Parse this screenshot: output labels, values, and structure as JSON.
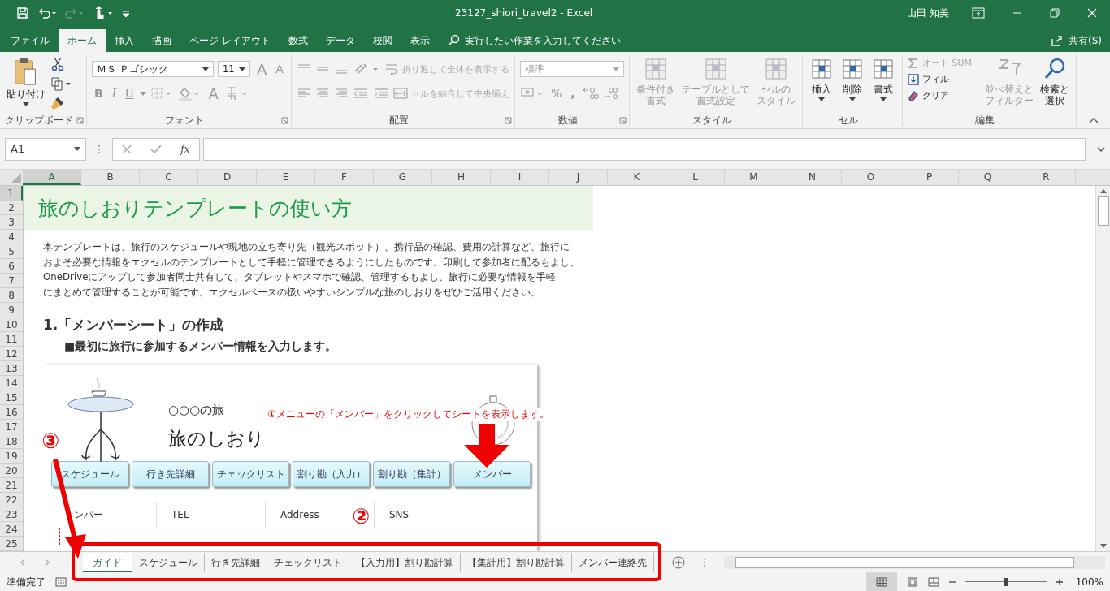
{
  "title_bar": {
    "title": "23127_shiori_travel2  -  Excel",
    "user": "山田 知美"
  },
  "menu_tabs": [
    {
      "label": "ファイル",
      "selected": false
    },
    {
      "label": "ホーム",
      "selected": true
    },
    {
      "label": "挿入",
      "selected": false
    },
    {
      "label": "描画",
      "selected": false
    },
    {
      "label": "ページ レイアウト",
      "selected": false
    },
    {
      "label": "数式",
      "selected": false
    },
    {
      "label": "データ",
      "selected": false
    },
    {
      "label": "校閲",
      "selected": false
    },
    {
      "label": "表示",
      "selected": false
    }
  ],
  "tell_me": {
    "placeholder": "実行したい作業を入力してください"
  },
  "share": "共有(S)",
  "ribbon": {
    "clipboard": {
      "name": "クリップボード",
      "paste": "貼り付け"
    },
    "font": {
      "name": "フォント",
      "font_name": "ＭＳ Ｐゴシック",
      "font_size": "11",
      "size_buttons": [
        "A",
        "A"
      ],
      "styles": [
        "B",
        "I",
        "U"
      ],
      "font_color": "A"
    },
    "alignment": {
      "name": "配置",
      "items": [
        {
          "label": "折り返して全体を表示する",
          "disabled": true
        },
        {
          "label": "セルを結合して中央揃え",
          "disabled": true
        }
      ]
    },
    "number": {
      "name": "数値",
      "format": {
        "value": "標準",
        "disabled": true
      },
      "percent": "%",
      "comma": ","
    },
    "styles": {
      "name": "スタイル",
      "items": [
        {
          "lines": [
            "条件付き",
            "書式"
          ],
          "disabled": true
        },
        {
          "lines": [
            "テーブルとして",
            "書式設定"
          ],
          "disabled": true
        },
        {
          "lines": [
            "セルの",
            "スタイル"
          ],
          "disabled": true
        }
      ]
    },
    "cells": {
      "name": "セル",
      "items": [
        {
          "lines": [
            "挿入"
          ],
          "disabled": false
        },
        {
          "lines": [
            "削除"
          ],
          "disabled": false
        },
        {
          "lines": [
            "書式"
          ],
          "disabled": false
        }
      ]
    },
    "editing": {
      "name": "編集",
      "small": [
        {
          "label": "オート SUM",
          "disabled": true
        },
        {
          "label": "フィル",
          "disabled": false
        },
        {
          "label": "クリア",
          "disabled": false
        }
      ],
      "big": [
        {
          "lines": [
            "並べ替えと",
            "フィルター"
          ],
          "disabled": true
        },
        {
          "lines": [
            "検索と",
            "選択"
          ],
          "disabled": false
        }
      ]
    }
  },
  "formula_bar": {
    "name_box": "A1",
    "fx": "fx"
  },
  "columns": [
    {
      "label": "A",
      "selected": true
    },
    {
      "label": "B",
      "selected": false
    },
    {
      "label": "C",
      "selected": false
    },
    {
      "label": "D",
      "selected": false
    },
    {
      "label": "E",
      "selected": false
    },
    {
      "label": "F",
      "selected": false
    },
    {
      "label": "G",
      "selected": false
    },
    {
      "label": "H",
      "selected": false
    },
    {
      "label": "I",
      "selected": false
    },
    {
      "label": "J",
      "selected": false
    },
    {
      "label": "K",
      "selected": false
    },
    {
      "label": "L",
      "selected": false
    },
    {
      "label": "M",
      "selected": false
    },
    {
      "label": "N",
      "selected": false
    },
    {
      "label": "O",
      "selected": false
    },
    {
      "label": "P",
      "selected": false
    },
    {
      "label": "Q",
      "selected": false
    },
    {
      "label": "R",
      "selected": false
    }
  ],
  "rows": [
    {
      "label": "1",
      "selected": true
    },
    {
      "label": "2",
      "selected": false
    },
    {
      "label": "3",
      "selected": false
    },
    {
      "label": "4",
      "selected": false
    },
    {
      "label": "5",
      "selected": false
    },
    {
      "label": "6",
      "selected": false
    },
    {
      "label": "7",
      "selected": false
    },
    {
      "label": "8",
      "selected": false
    },
    {
      "label": "9",
      "selected": false
    },
    {
      "label": "10",
      "selected": false
    },
    {
      "label": "11",
      "selected": false
    },
    {
      "label": "12",
      "selected": false
    },
    {
      "label": "13",
      "selected": false
    },
    {
      "label": "14",
      "selected": false
    },
    {
      "label": "15",
      "selected": false
    },
    {
      "label": "16",
      "selected": false
    },
    {
      "label": "17",
      "selected": false
    },
    {
      "label": "18",
      "selected": false
    },
    {
      "label": "19",
      "selected": false
    },
    {
      "label": "20",
      "selected": false
    },
    {
      "label": "21",
      "selected": false
    },
    {
      "label": "22",
      "selected": false
    },
    {
      "label": "23",
      "selected": false
    },
    {
      "label": "24",
      "selected": false
    },
    {
      "label": "25",
      "selected": false
    }
  ],
  "sheet": {
    "title": "旅のしおりテンプレートの使い方",
    "paragraph_lines": [
      "本テンプレートは、旅行のスケジュールや現地の立ち寄り先（観光スポット）、携行品の確認、費用の計算など、旅行に",
      "およそ必要な情報をエクセルのテンプレートとして手軽に管理できるようにしたものです。印刷して参加者に配るもよし、",
      "OneDriveにアップして参加者同士共有して、タブレットやスマホで確認、管理するもよし、旅行に必要な情報を手軽",
      "にまとめて管理することが可能です。エクセルベースの扱いやすいシンプルな旅のしおりをぜひご活用ください。"
    ],
    "heading": "1.「メンバーシート」の作成",
    "subheading": "■最初に旅行に参加するメンバー情報を入力します。"
  },
  "embedded": {
    "trip": "○○○の旅",
    "title": "旅のしおり",
    "note": "①メニューの「メンバー」をクリックしてシートを表示します。",
    "buttons": [
      "スケジュール",
      "行き先詳細",
      "チェックリスト",
      "割り勘（入力）",
      "割り勘（集計）",
      "メンバー"
    ],
    "table_headers": [
      "ンバー",
      "TEL",
      "Address",
      "SNS"
    ]
  },
  "callouts": [
    "③",
    "②"
  ],
  "sheet_tabs": [
    {
      "label": "ガイド",
      "selected": true
    },
    {
      "label": "スケジュール",
      "selected": false
    },
    {
      "label": "行き先詳細",
      "selected": false
    },
    {
      "label": "チェックリスト",
      "selected": false
    },
    {
      "label": "【入力用】割り勘計算",
      "selected": false
    },
    {
      "label": "【集計用】割り勘計算",
      "selected": false
    },
    {
      "label": "メンバー連絡先",
      "selected": false
    }
  ],
  "status_bar": {
    "status": "準備完了",
    "zoom": {
      "level": 0.5,
      "reading": "100%"
    }
  }
}
